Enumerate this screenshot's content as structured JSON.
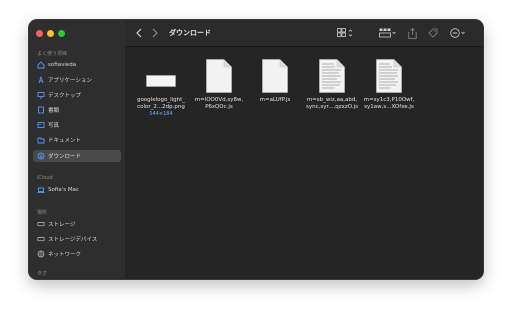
{
  "window": {
    "title": "ダウンロード"
  },
  "sidebar": {
    "favorites_title": "よく使う項目",
    "favorites": [
      {
        "label": "sofiavieda",
        "icon": "home-icon"
      },
      {
        "label": "アプリケーション",
        "icon": "apps-icon"
      },
      {
        "label": "デスクトップ",
        "icon": "desktop-icon"
      },
      {
        "label": "書類",
        "icon": "document-icon"
      },
      {
        "label": "写真",
        "icon": "photo-icon"
      },
      {
        "label": "ドキュメント",
        "icon": "folder-icon"
      },
      {
        "label": "ダウンロード",
        "icon": "download-icon",
        "active": true
      }
    ],
    "icloud_title": "iCloud",
    "icloud": [
      {
        "label": "Sofia's Mac",
        "icon": "laptop-icon"
      }
    ],
    "locations_title": "場所",
    "locations": [
      {
        "label": "ストレージ",
        "icon": "drive-icon"
      },
      {
        "label": "ストレージデバイス",
        "icon": "drive-icon"
      },
      {
        "label": "ネットワーク",
        "icon": "network-icon"
      }
    ],
    "tags_title": "タグ"
  },
  "files": [
    {
      "name_line1": "googlelogo_light_",
      "name_line2": "color_2...2dp.png",
      "meta": "544×184",
      "kind": "image"
    },
    {
      "name_line1": "m=lOO0Vd,sy8w,",
      "name_line2": "P6sQOc.js",
      "meta": "",
      "kind": "blank"
    },
    {
      "name_line1": "m=aLUfP.js",
      "name_line2": "",
      "meta": "",
      "kind": "blank"
    },
    {
      "name_line1": "m=sb_wiz,aa,abd,",
      "name_line2": "sync,syr...,qzxzO.js",
      "meta": "",
      "kind": "text"
    },
    {
      "name_line1": "m=sy1c3,P10Owf,",
      "name_line2": "sy1aw,s...XOfxe.js",
      "meta": "",
      "kind": "text"
    }
  ],
  "colors": {
    "accent": "#6fa8ff",
    "window_bg": "#252525",
    "sidebar_bg": "#2e2e2e"
  }
}
